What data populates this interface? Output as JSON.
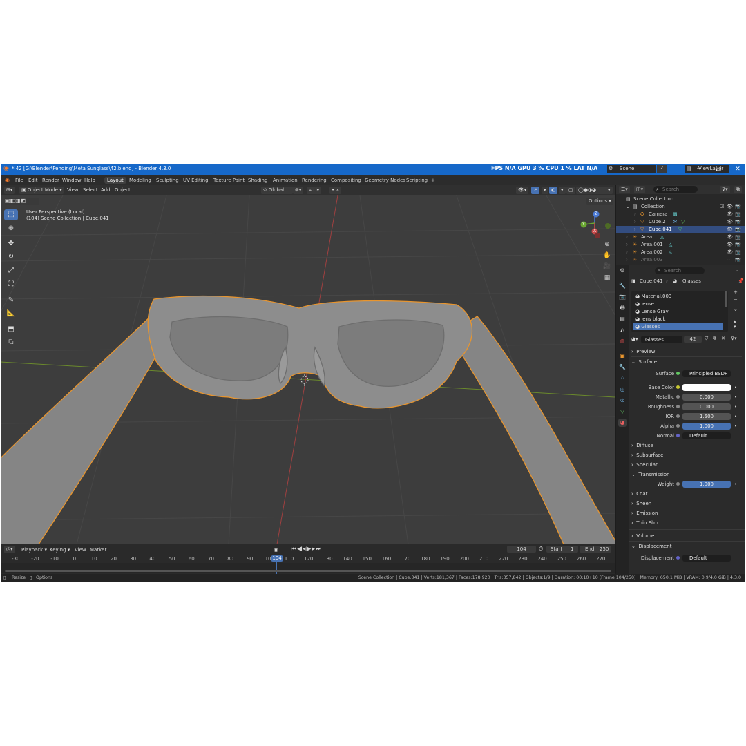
{
  "titlebar": {
    "title": "* 42 [G:\\Blender\\Pending\\Meta Sunglass\\42.blend] - Blender 4.3.0",
    "stats": "FPS  N/A  GPU  3 %  CPU  1 %  LAT  N/A",
    "scene_label": "Scene",
    "scene_count": "2",
    "viewlayer_label": "ViewLayer",
    "minimize": "─",
    "maximize": "☐",
    "close": "✕"
  },
  "menubar": {
    "menus": [
      "File",
      "Edit",
      "Render",
      "Window",
      "Help"
    ],
    "workspaces": [
      "Layout",
      "Modeling",
      "Sculpting",
      "UV Editing",
      "Texture Paint",
      "Shading",
      "Animation",
      "Rendering",
      "Compositing",
      "Geometry Nodes",
      "Scripting"
    ],
    "add_workspace": "+"
  },
  "viewport_header": {
    "mode": "Object Mode",
    "menus": [
      "View",
      "Select",
      "Add",
      "Object"
    ],
    "orientation": "Global",
    "options": "Options"
  },
  "viewport": {
    "perspective": "User Perspective (Local)",
    "collection_info": "(104) Scene Collection | Cube.041",
    "gizmo_axes": [
      "Z",
      "Y",
      "X"
    ]
  },
  "timeline": {
    "menus": [
      "Playback",
      "Keying",
      "View",
      "Marker"
    ],
    "current_frame": "104",
    "start_label": "Start",
    "start_value": "1",
    "end_label": "End",
    "end_value": "250",
    "ticks": [
      "-30",
      "-20",
      "-10",
      "0",
      "10",
      "20",
      "30",
      "40",
      "50",
      "60",
      "70",
      "80",
      "90",
      "100",
      "110",
      "120",
      "130",
      "140",
      "150",
      "160",
      "170",
      "180",
      "190",
      "200",
      "210",
      "220",
      "230",
      "240",
      "250",
      "260",
      "270"
    ],
    "playhead": "104"
  },
  "statusbar": {
    "left1": "Resize",
    "left2": "Options",
    "right": "Scene Collection | Cube.041 | Verts:181,367 | Faces:178,920 | Tris:357,842 | Objects:1/9 | Duration: 00:10+10 (Frame 104/250) | Memory: 650.1 MiB | VRAM: 0.9/4.0 GiB | 4.3.0"
  },
  "outliner": {
    "search_placeholder": "Search",
    "items": [
      {
        "label": "Scene Collection"
      },
      {
        "label": "Collection"
      },
      {
        "label": "Camera"
      },
      {
        "label": "Cube.2"
      },
      {
        "label": "Cube.041"
      },
      {
        "label": "Area"
      },
      {
        "label": "Area.001"
      },
      {
        "label": "Area.002"
      },
      {
        "label": "Area.003"
      }
    ]
  },
  "properties": {
    "search_placeholder": "Search",
    "breadcrumb_object": "Cube.041",
    "breadcrumb_material": "Glasses",
    "material_slots": [
      "Material.003",
      "lense",
      "Lense Gray",
      "lens black",
      "Glasses"
    ],
    "material_name": "Glasses",
    "material_users": "42",
    "sections": {
      "preview": "Preview",
      "surface": "Surface",
      "diffuse": "Diffuse",
      "subsurface": "Subsurface",
      "specular": "Specular",
      "transmission": "Transmission",
      "coat": "Coat",
      "sheen": "Sheen",
      "emission": "Emission",
      "thin_film": "Thin Film",
      "volume": "Volume",
      "displacement": "Displacement"
    },
    "surface_label": "Surface",
    "surface_value": "Principled BSDF",
    "base_color_label": "Base Color",
    "base_color": "#ffffff",
    "metallic_label": "Metallic",
    "metallic": "0.000",
    "roughness_label": "Roughness",
    "roughness": "0.000",
    "ior_label": "IOR",
    "ior": "1.500",
    "alpha_label": "Alpha",
    "alpha": "1.000",
    "normal_label": "Normal",
    "normal": "Default",
    "weight_label": "Weight",
    "weight": "1.000",
    "displacement_label": "Displacement",
    "displacement": "Default"
  },
  "colors": {
    "accent": "#4772b3",
    "selection_outline": "#e8952e",
    "titlebar": "#1668c9"
  }
}
